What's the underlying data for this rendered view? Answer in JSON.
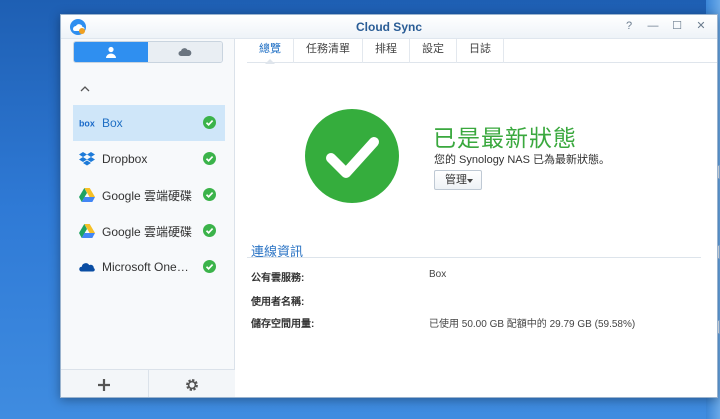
{
  "window": {
    "title": "Cloud Sync"
  },
  "window_controls": {
    "help": "?",
    "minimize": "—",
    "maximize": "☐",
    "close": "✕"
  },
  "sidebar": {
    "segments": [
      {
        "name": "user",
        "active": true
      },
      {
        "name": "cloud",
        "active": false
      }
    ],
    "items": [
      {
        "label": "Box",
        "icon": "box-logo-icon",
        "selected": true,
        "status": "ok"
      },
      {
        "label": "Dropbox",
        "icon": "dropbox-logo-icon",
        "selected": false,
        "status": "ok"
      },
      {
        "label": "Google 雲端硬碟",
        "icon": "google-drive-icon",
        "selected": false,
        "status": "ok"
      },
      {
        "label": "Google 雲端硬碟",
        "icon": "google-drive-icon",
        "selected": false,
        "status": "ok"
      },
      {
        "label": "Microsoft One…",
        "icon": "onedrive-icon",
        "selected": false,
        "status": "ok"
      }
    ]
  },
  "tabs": [
    {
      "label": "總覽",
      "active": true
    },
    {
      "label": "任務清單",
      "active": false
    },
    {
      "label": "排程",
      "active": false
    },
    {
      "label": "設定",
      "active": false
    },
    {
      "label": "日誌",
      "active": false
    }
  ],
  "overview": {
    "status_title": "已是最新狀態",
    "status_subtitle": "您的 Synology NAS 已為最新狀態。",
    "manage_label": "管理"
  },
  "connection": {
    "section_title": "連線資訊",
    "rows": [
      {
        "label": "公有雲服務:",
        "value": "Box"
      },
      {
        "label": "使用者名稱:",
        "value": ""
      },
      {
        "label": "儲存空間用量:",
        "value": "已使用 50.00 GB 配額中的 29.79 GB (59.58%)"
      }
    ]
  },
  "colors": {
    "accent": "#2f8ff0",
    "success": "#35ad3d",
    "title": "#2a5d96"
  }
}
